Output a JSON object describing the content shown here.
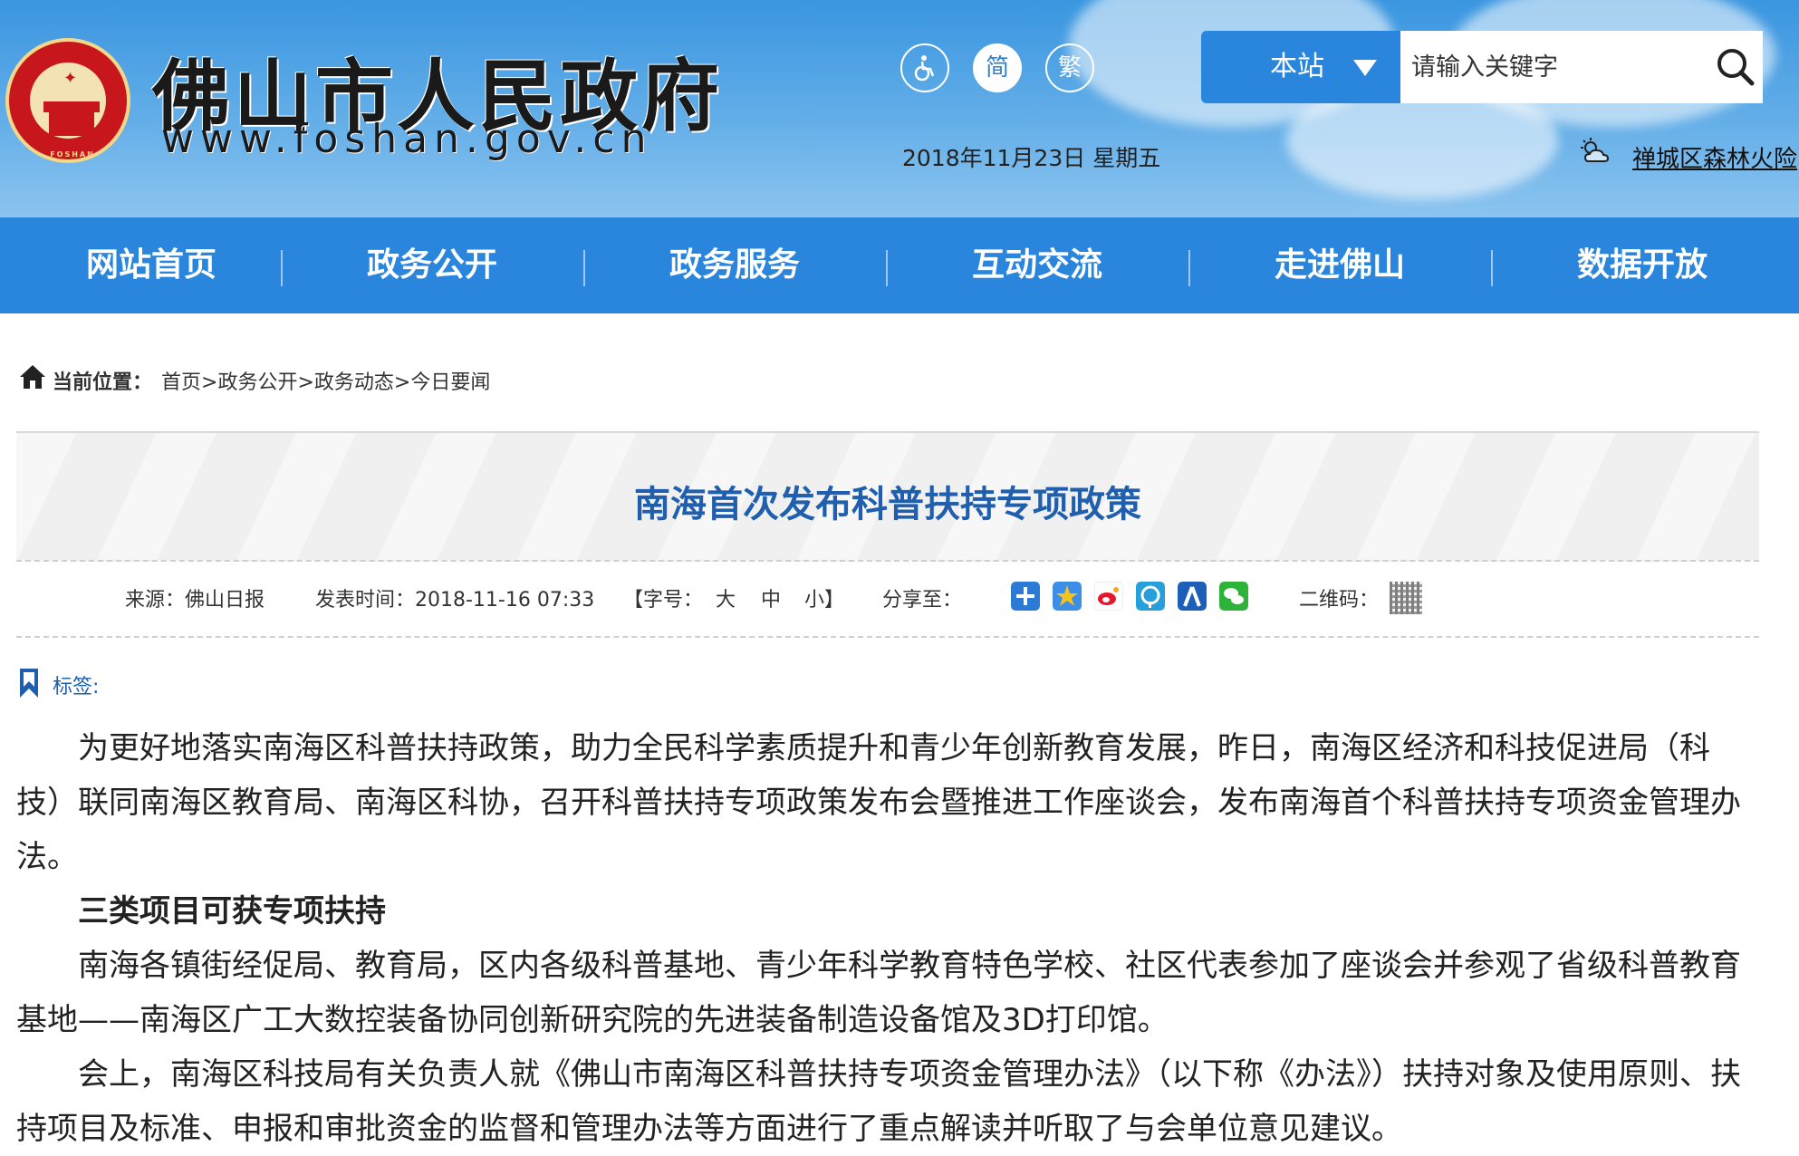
{
  "header": {
    "site_title": "佛山市人民政府",
    "site_url": "www.foshan.gov.cn",
    "emblem_text": "FOSHAN",
    "accessibility_icon": "wheelchair-icon",
    "simplified_label": "简",
    "traditional_label": "繁",
    "date": "2018年11月23日 星期五",
    "weather_icon": "partly-cloudy-icon",
    "weather_link": "禅城区森林火险"
  },
  "search": {
    "scope_label": "本站",
    "placeholder": "请输入关键字",
    "button_icon": "search-icon"
  },
  "nav": {
    "items": [
      "网站首页",
      "政务公开",
      "政务服务",
      "互动交流",
      "走进佛山",
      "数据开放"
    ]
  },
  "breadcrumb": {
    "label": "当前位置：",
    "items": [
      "首页",
      "政务公开",
      "政务动态",
      "今日要闻"
    ],
    "separator": ">"
  },
  "article": {
    "title": "南海首次发布科普扶持专项政策",
    "source": "来源：佛山日报",
    "publish_time": "发表时间：2018-11-16 07:33",
    "font_size_prefix": "【字号：",
    "font_size_large": "大",
    "font_size_medium": "中",
    "font_size_small": "小】",
    "share_label": "分享至：",
    "share_icons": [
      "share-plus-icon",
      "qzone-icon",
      "weibo-icon",
      "pengyou-icon",
      "renren-icon",
      "wechat-icon"
    ],
    "qr_label": "二维码：",
    "tag_label": "标签:",
    "paragraphs": [
      "为更好地落实南海区科普扶持政策，助力全民科学素质提升和青少年创新教育发展，昨日，南海区经济和科技促进局（科技）联同南海区教育局、南海区科协，召开科普扶持专项政策发布会暨推进工作座谈会，发布南海首个科普扶持专项资金管理办法。",
      "三类项目可获专项扶持",
      "南海各镇街经促局、教育局，区内各级科普基地、青少年科学教育特色学校、社区代表参加了座谈会并参观了省级科普教育基地——南海区广工大数控装备协同创新研究院的先进装备制造设备馆及3D打印馆。",
      "会上，南海区科技局有关负责人就《佛山市南海区科普扶持专项资金管理办法》（以下称《办法》）扶持对象及使用原则、扶持项目及标准、申报和审批资金的监督和管理办法等方面进行了重点解读并听取了与会单位意见建议。"
    ]
  },
  "colors": {
    "nav_blue": "#2a86dd",
    "title_blue": "#1f5fae",
    "emblem_red": "#c8161d"
  }
}
